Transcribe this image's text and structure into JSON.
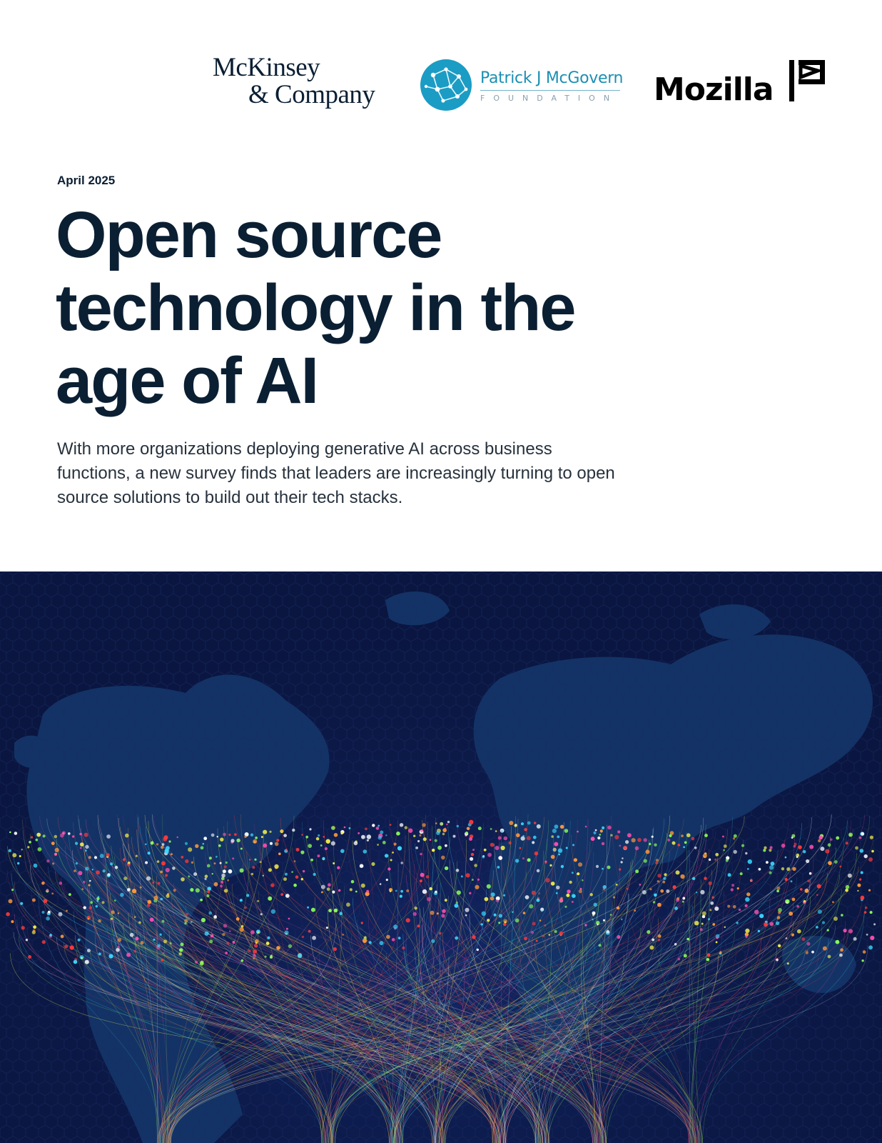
{
  "logos": {
    "mckinsey_line1": "McKinsey",
    "mckinsey_line2": "& Company",
    "mcgovern_name": "Patrick J McGovern",
    "mcgovern_sub": "FOUNDATION",
    "mozilla": "Mozilla"
  },
  "report": {
    "date": "April 2025",
    "title_lines": [
      "Open source",
      "technology in the",
      "age of AI"
    ],
    "lede": "With more organizations deploying generative AI across business functions, a new survey finds that leaders are increasingly turning to open source solutions to build out their tech stacks."
  },
  "hero": {
    "background": "#0a1640",
    "map_color": "#133366",
    "light_colors": [
      "#3ad8ff",
      "#f4f04a",
      "#ff4fb0",
      "#8cff5a",
      "#ff3a3a",
      "#ffffff",
      "#ff9a3a"
    ]
  }
}
